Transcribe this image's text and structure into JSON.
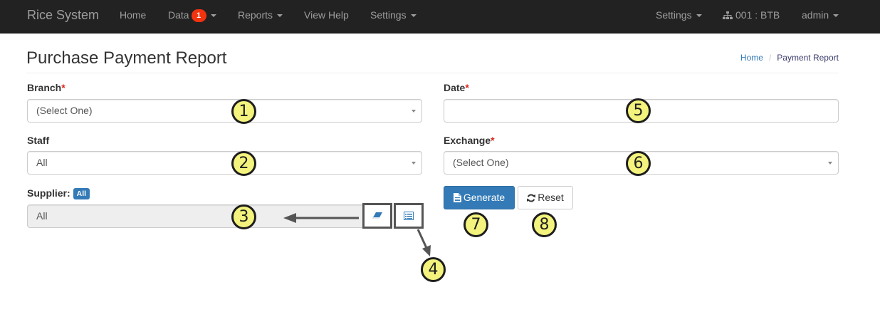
{
  "navbar": {
    "brand": "Rice System",
    "left_items": [
      {
        "label": "Home"
      },
      {
        "label": "Data",
        "badge": "1"
      },
      {
        "label": "Reports"
      },
      {
        "label": "View Help"
      },
      {
        "label": "Settings"
      }
    ],
    "right_items": {
      "settings": "Settings",
      "branch": "001 : BTB",
      "user": "admin"
    }
  },
  "page": {
    "title": "Purchase Payment Report",
    "breadcrumb": {
      "home": "Home",
      "current": "Payment Report"
    }
  },
  "form": {
    "branch": {
      "label": "Branch",
      "required_mark": "*",
      "value": "(Select One)"
    },
    "staff": {
      "label": "Staff",
      "value": "All"
    },
    "supplier": {
      "label": "Supplier:",
      "badge": "All",
      "value": "All"
    },
    "date": {
      "label": "Date",
      "required_mark": "*",
      "value": ""
    },
    "exchange": {
      "label": "Exchange",
      "required_mark": "*",
      "value": "(Select One)"
    },
    "buttons": {
      "generate": "Generate",
      "reset": "Reset"
    }
  },
  "callouts": [
    "1",
    "2",
    "3",
    "4",
    "5",
    "6",
    "7",
    "8"
  ],
  "colors": {
    "navbar_bg": "#222222",
    "primary": "#337ab7",
    "badge_red": "#f2330f",
    "required": "#d9251d",
    "callout_fill": "#f3f37d"
  }
}
